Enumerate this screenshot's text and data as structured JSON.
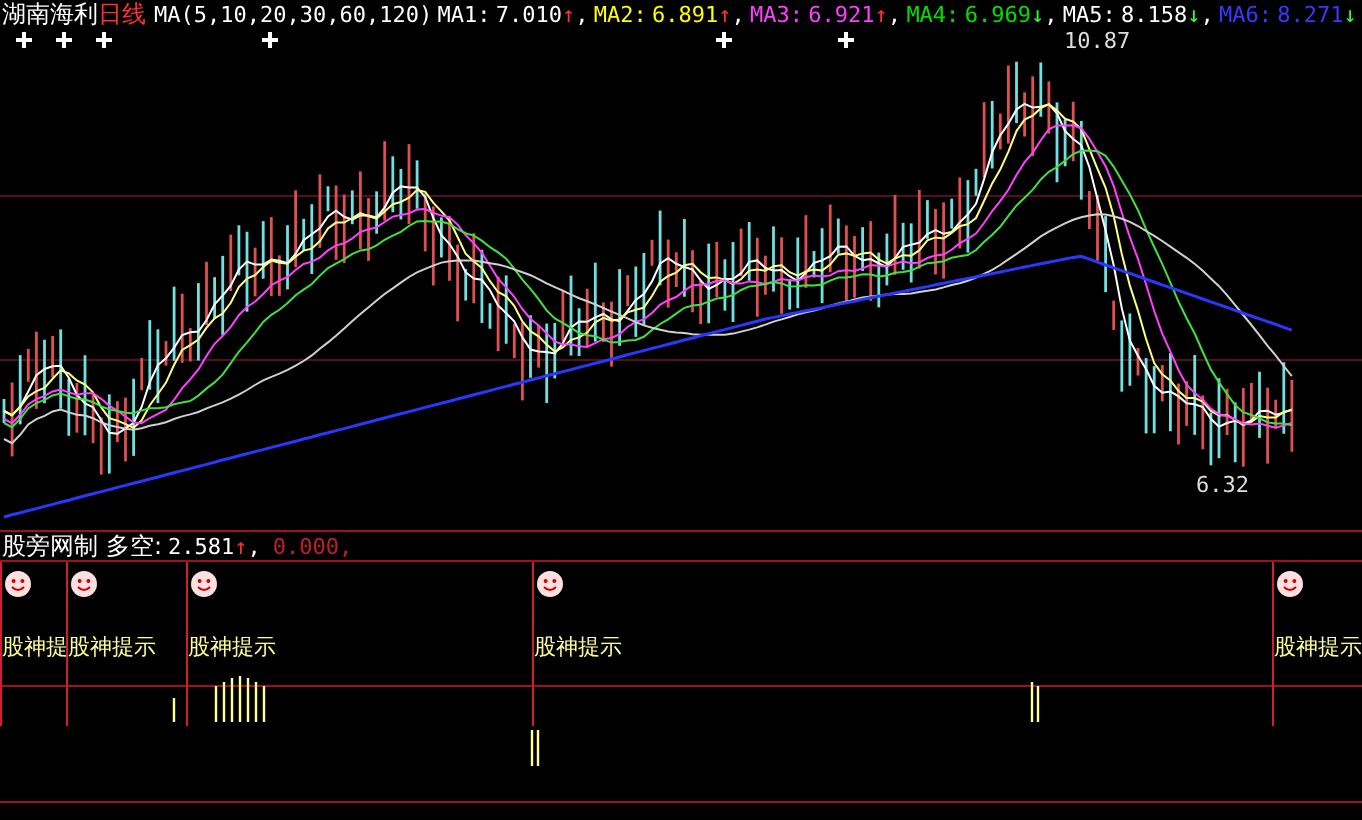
{
  "header": {
    "stock": "湖南海利",
    "period": "日线",
    "indicator": "MA(5,10,20,30,60,120)",
    "averages": [
      {
        "label": "MA1:",
        "value": "7.010",
        "arrow": "↑",
        "rising": true,
        "sep": ",",
        "color": "#ffffff"
      },
      {
        "label": "MA2:",
        "value": "6.891",
        "arrow": "↑",
        "rising": true,
        "sep": ",",
        "color": "#ffff00"
      },
      {
        "label": "MA3:",
        "value": "6.921",
        "arrow": "↑",
        "rising": true,
        "sep": ",",
        "color": "#ff40ff"
      },
      {
        "label": "MA4:",
        "value": "6.969",
        "arrow": "↓",
        "rising": false,
        "sep": ",",
        "color": "#00e000"
      },
      {
        "label": "MA5:",
        "value": "8.158",
        "arrow": "↓",
        "rising": false,
        "sep": ",",
        "color": "#ffffff"
      },
      {
        "label": "MA6:",
        "value": "8.271",
        "arrow": "↓",
        "rising": false,
        "color": "#3838ff"
      }
    ]
  },
  "price_chart": {
    "high_label": "10.87",
    "low_label": "6.32"
  },
  "indicator_panel": {
    "name": "股旁网制",
    "label": "多空:",
    "value": "2.581",
    "arrow": "↑",
    "rising": true,
    "sep": ",",
    "second_value": "0.000,",
    "signals": [
      {
        "label": "股神提"
      },
      {
        "label": "股神提示"
      },
      {
        "label": "股神提示"
      },
      {
        "label": "股神提示"
      },
      {
        "label": "股神提示"
      }
    ]
  }
}
